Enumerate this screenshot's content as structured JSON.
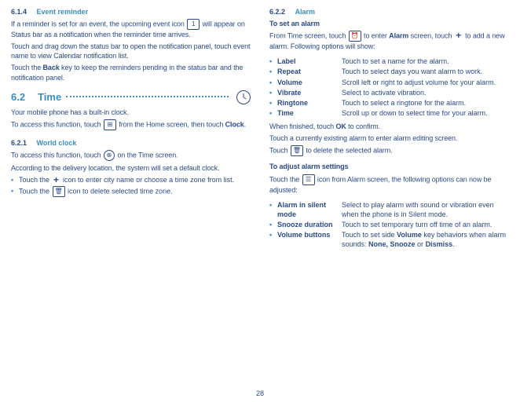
{
  "left": {
    "s614_num": "6.1.4",
    "s614_title": "Event reminder",
    "p1a": "If a reminder is set for an event, the upcoming event icon ",
    "icon_one": "1",
    "p1b": " will appear on Status bar as a notification when the reminder time arrives.",
    "p2": "Touch and drag down the status bar to open the notification panel, touch event name to view Calendar notification list.",
    "p3a": "Touch the ",
    "back": "Back",
    "p3b": " key to keep the reminders pending in the status bar and the notification panel.",
    "s62_num": "6.2",
    "s62_title": "Time",
    "p4": "Your mobile phone has a built-in clock.",
    "p5a": "To access this function, touch ",
    "p5b": " from the Home screen, then touch ",
    "clock": "Clock",
    "s621_num": "6.2.1",
    "s621_title": "World clock",
    "p6a": "To access this function, touch ",
    "p6b": " on the Time screen.",
    "p7": "According to the delivery location, the system will set a default clock.",
    "b1a": "Touch the ",
    "b1b": " icon to enter city name or choose a time zone from list.",
    "b2a": "Touch the ",
    "b2b": " icon to delete selected time zone."
  },
  "right": {
    "s622_num": "6.2.2",
    "s622_title": "Alarm",
    "h_set": "To set an alarm",
    "p1a": "From Time screen, touch ",
    "p1b": " to enter ",
    "alarm": "Alarm",
    "p1c": " screen, touch ",
    "p1d": " to add a new alarm. Following options will show:",
    "opts": [
      {
        "label": "Label",
        "desc": "Touch to set a name for the alarm."
      },
      {
        "label": "Repeat",
        "desc": "Touch to select days you want alarm to work."
      },
      {
        "label": "Volume",
        "desc": "Scroll left or right to adjust volume for your alarm."
      },
      {
        "label": "Vibrate",
        "desc": "Select to activate vibration."
      },
      {
        "label": "Ringtone",
        "desc": "Touch to select a ringtone for the alarm."
      },
      {
        "label": "Time",
        "desc": "Scroll up or down to select time for your alarm."
      }
    ],
    "p2a": "When finished, touch ",
    "ok": "OK",
    "p2b": " to confirm.",
    "p3": "Touch a currently existing alarm to enter alarm editing screen.",
    "p4a": "Touch ",
    "p4b": " to delete the selected alarm.",
    "h_adj": "To adjust alarm settings",
    "p5a": "Touch the ",
    "p5b": " icon from Alarm screen, the following options can now be adjusted:",
    "opts2": [
      {
        "label": "Alarm in silent mode",
        "desc": "Select to play alarm with sound or vibration even when the phone is in Silent mode."
      },
      {
        "label": "Snooze duration",
        "desc": "Touch to set temporary turn off time of an alarm."
      }
    ],
    "vb_label": "Volume buttons",
    "vb_a": "Touch to set side ",
    "vb_vol": "Volume",
    "vb_b": " key behaviors when alarm sounds: ",
    "vb_none": "None, Snooze",
    "vb_or": " or ",
    "vb_dis": "Dismiss",
    "vb_dot": "."
  },
  "pagenum": "28"
}
